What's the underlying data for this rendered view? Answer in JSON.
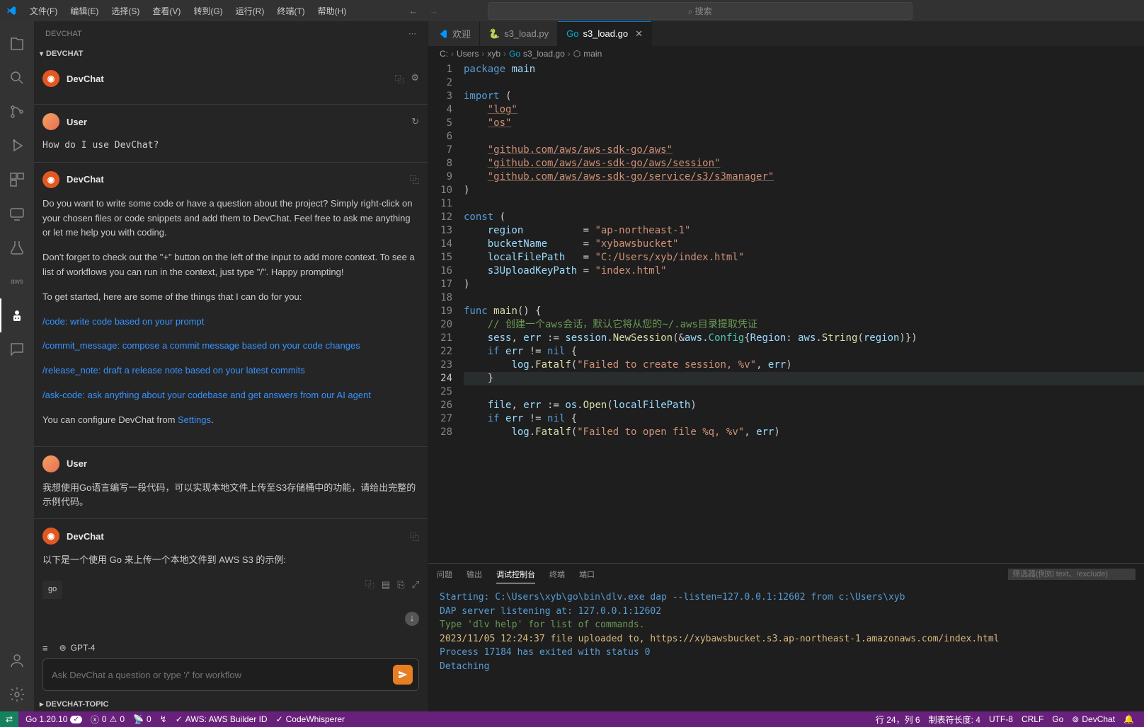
{
  "titlebar": {
    "menus": [
      "文件(F)",
      "编辑(E)",
      "选择(S)",
      "查看(V)",
      "转到(G)",
      "运行(R)",
      "终端(T)",
      "帮助(H)"
    ],
    "search_placeholder": "搜索"
  },
  "sidebar": {
    "title": "DEVCHAT",
    "section": "DEVCHAT",
    "topic": "DEVCHAT-TOPIC"
  },
  "chat": {
    "messages": [
      {
        "role": "DevChat",
        "avatar": "dev",
        "body": "",
        "sys": true
      },
      {
        "role": "User",
        "avatar": "user",
        "body": "How do I use DevChat?"
      },
      {
        "role": "DevChat",
        "avatar": "dev",
        "body_paras": [
          "Do you want to write some code or have a question about the project? Simply right-click on your chosen files or code snippets and add them to DevChat. Feel free to ask me anything or let me help you with coding.",
          "Don't forget to check out the \"+\" button on the left of the input to add more context. To see a list of workflows you can run in the context, just type \"/\". Happy prompting!",
          "To get started, here are some of the things that I can do for you:"
        ],
        "links": [
          "/code: write code based on your prompt",
          "/commit_message: compose a commit message based on your code changes",
          "/release_note: draft a release note based on your latest commits",
          "/ask-code: ask anything about your codebase and get answers from our AI agent"
        ],
        "tail": "You can configure DevChat from ",
        "tail_link": "Settings",
        "tail_end": "."
      },
      {
        "role": "User",
        "avatar": "user",
        "body": "我想使用Go语言编写一段代码，可以实现本地文件上传至S3存储桶中的功能，请给出完整的示例代码。"
      },
      {
        "role": "DevChat",
        "avatar": "dev",
        "body": "以下是一个使用 Go 来上传一个本地文件到 AWS S3 的示例:",
        "code_lang": "go"
      }
    ],
    "model": "GPT-4",
    "input_placeholder": "Ask DevChat a question or type '/' for workflow"
  },
  "tabs": [
    {
      "icon": "vscode",
      "label": "欢迎",
      "active": false
    },
    {
      "icon": "python",
      "label": "s3_load.py",
      "active": false
    },
    {
      "icon": "go",
      "label": "s3_load.go",
      "active": true,
      "close": true
    }
  ],
  "breadcrumb": [
    "C:",
    "Users",
    "xyb",
    "s3_load.go",
    "main"
  ],
  "code": {
    "lines": [
      {
        "n": 1,
        "html": "<span class='kw'>package</span> <span class='va'>main</span>"
      },
      {
        "n": 2,
        "html": ""
      },
      {
        "n": 3,
        "html": "<span class='kw'>import</span> <span class='pu'>(</span>"
      },
      {
        "n": 4,
        "html": "    <span class='str u'>\"log\"</span>"
      },
      {
        "n": 5,
        "html": "    <span class='str u'>\"os\"</span>"
      },
      {
        "n": 6,
        "html": ""
      },
      {
        "n": 7,
        "html": "    <span class='str u'>\"github.com/aws/aws-sdk-go/aws\"</span>"
      },
      {
        "n": 8,
        "html": "    <span class='str u'>\"github.com/aws/aws-sdk-go/aws/session\"</span>"
      },
      {
        "n": 9,
        "html": "    <span class='str u'>\"github.com/aws/aws-sdk-go/service/s3/s3manager\"</span>"
      },
      {
        "n": 10,
        "html": "<span class='pu'>)</span>"
      },
      {
        "n": 11,
        "html": ""
      },
      {
        "n": 12,
        "html": "<span class='kw'>const</span> <span class='pu'>(</span>"
      },
      {
        "n": 13,
        "html": "    <span class='va'>region</span>          = <span class='str'>\"ap-northeast-1\"</span>"
      },
      {
        "n": 14,
        "html": "    <span class='va'>bucketName</span>      = <span class='str'>\"xybawsbucket\"</span>"
      },
      {
        "n": 15,
        "html": "    <span class='va'>localFilePath</span>   = <span class='str'>\"C:/Users/xyb/index.html\"</span>"
      },
      {
        "n": 16,
        "html": "    <span class='va'>s3UploadKeyPath</span> = <span class='str'>\"index.html\"</span>"
      },
      {
        "n": 17,
        "html": "<span class='pu'>)</span>"
      },
      {
        "n": 18,
        "html": ""
      },
      {
        "n": 19,
        "html": "<span class='kw'>func</span> <span class='fn'>main</span><span class='pu'>() {</span>"
      },
      {
        "n": 20,
        "html": "    <span class='cm'>// 创建一个aws会话，默认它将从您的~/.aws目录提取凭证</span>"
      },
      {
        "n": 21,
        "html": "    <span class='va'>sess</span>, <span class='va'>err</span> := <span class='va'>session</span>.<span class='fn'>NewSession</span>(&amp;<span class='va'>aws</span>.<span class='ty'>Config</span>{<span class='va'>Region</span>: <span class='va'>aws</span>.<span class='fn'>String</span>(<span class='va'>region</span>)})"
      },
      {
        "n": 22,
        "html": "    <span class='kw'>if</span> <span class='va'>err</span> != <span class='kw'>nil</span> {"
      },
      {
        "n": 23,
        "html": "        <span class='va'>log</span>.<span class='fn'>Fatalf</span>(<span class='str'>\"Failed to create session, %v\"</span>, <span class='va'>err</span>)"
      },
      {
        "n": 24,
        "html": "    }",
        "cur": true
      },
      {
        "n": 25,
        "html": ""
      },
      {
        "n": 26,
        "html": "    <span class='va'>file</span>, <span class='va'>err</span> := <span class='va'>os</span>.<span class='fn'>Open</span>(<span class='va'>localFilePath</span>)"
      },
      {
        "n": 27,
        "html": "    <span class='kw'>if</span> <span class='va'>err</span> != <span class='kw'>nil</span> {"
      },
      {
        "n": 28,
        "html": "        <span class='va'>log</span>.<span class='fn'>Fatalf</span>(<span class='str'>\"Failed to open file %q, %v\"</span>, <span class='va'>err</span>)"
      }
    ]
  },
  "panel": {
    "tabs": [
      "问题",
      "输出",
      "调试控制台",
      "终端",
      "端口"
    ],
    "active_tab": "调试控制台",
    "filter_placeholder": "筛选器(例如 text、!exclude)",
    "lines": [
      {
        "cls": "term-blue",
        "text": "Starting: C:\\Users\\xyb\\go\\bin\\dlv.exe dap --listen=127.0.0.1:12602 from c:\\Users\\xyb"
      },
      {
        "cls": "term-blue",
        "text": "DAP server listening at: 127.0.0.1:12602"
      },
      {
        "cls": "term-green",
        "text": "Type 'dlv help' for list of commands."
      },
      {
        "cls": "term-yellow",
        "text": "2023/11/05 12:24:37 file uploaded to, https://xybawsbucket.s3.ap-northeast-1.amazonaws.com/index.html"
      },
      {
        "cls": "term-blue",
        "text": "Process 17184 has exited with status 0"
      },
      {
        "cls": "term-blue",
        "text": "Detaching"
      }
    ]
  },
  "statusbar": {
    "go_version": "Go 1.20.10",
    "errors": "0",
    "warnings": "0",
    "ports": "0",
    "aws": "AWS: AWS Builder ID",
    "codewhisperer": "CodeWhisperer",
    "ln_col": "行 24，列 6",
    "tab_size": "制表符长度: 4",
    "encoding": "UTF-8",
    "eol": "CRLF",
    "lang": "Go",
    "devchat": "DevChat"
  }
}
